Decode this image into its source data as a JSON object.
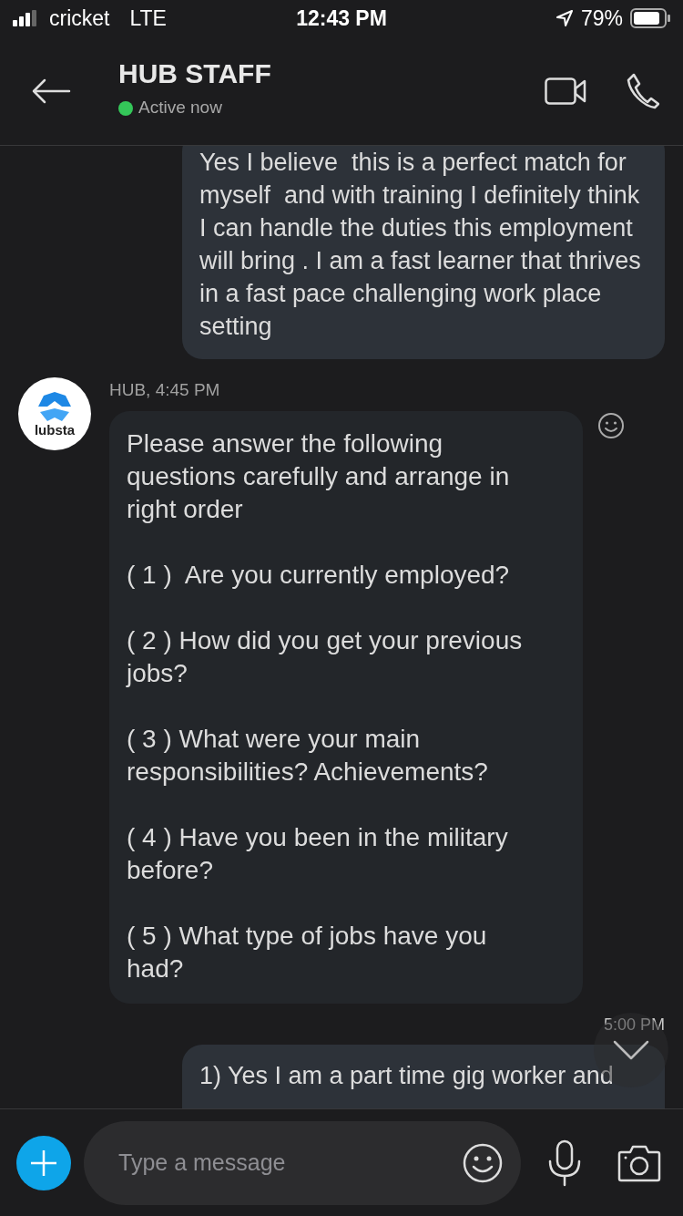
{
  "status_bar": {
    "carrier": "cricket",
    "network": "LTE",
    "time": "12:43 PM",
    "battery": "79%"
  },
  "header": {
    "title": "HUB STAFF",
    "presence": "Active now",
    "online": true
  },
  "messages": [
    {
      "kind": "outgoing",
      "paragraphs": [
        "Yes I believe  this is a perfect match for myself  and with training I definitely think I can handle the duties this employment will bring . I am a fast learner that thrives in a fast pace challenging work place setting"
      ]
    },
    {
      "kind": "incoming",
      "sender": "HUB, 4:45 PM",
      "avatar_text": "lubsta",
      "paragraphs": [
        "Please answer the following questions carefully and arrange in right order",
        "( 1 )  Are you currently employed?",
        "( 2 ) How did you get your previous jobs?",
        "( 3 ) What were your main responsibilities? Achievements?",
        "( 4 ) Have you been in the military before?",
        "( 5 ) What type of jobs have you had?"
      ]
    },
    {
      "kind": "outgoing",
      "time": "5:00 PM",
      "paragraphs": [
        "1) Yes I am a part time gig worker and"
      ]
    }
  ],
  "composer": {
    "placeholder": "Type a message"
  }
}
